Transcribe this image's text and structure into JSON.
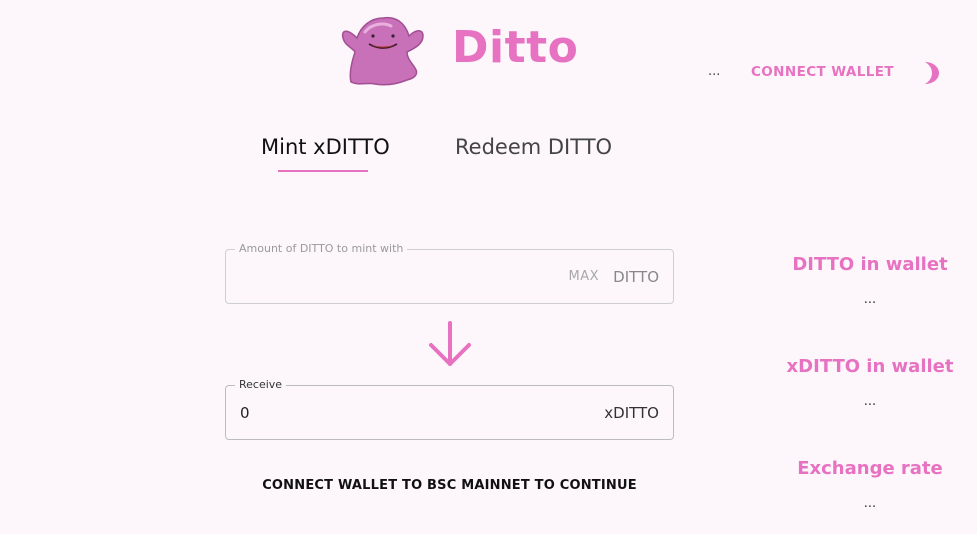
{
  "header": {
    "brand": "Ditto",
    "address_placeholder": "...",
    "connect_label": "CONNECT WALLET",
    "theme_icon": "moon-icon",
    "logo_icon": "ditto-mascot-icon",
    "accent_color": "#e772c1"
  },
  "tabs": [
    {
      "label": "Mint xDITTO",
      "active": true
    },
    {
      "label": "Redeem DITTO",
      "active": false
    }
  ],
  "mint_form": {
    "amount_label": "Amount of DITTO to mint with",
    "amount_value": "",
    "max_label": "MAX",
    "amount_unit": "DITTO",
    "arrow_icon": "arrow-down-icon",
    "receive_label": "Receive",
    "receive_value": "0",
    "receive_unit": "xDITTO",
    "notice": "CONNECT WALLET TO BSC MAINNET TO CONTINUE"
  },
  "stats": [
    {
      "label": "DITTO in wallet",
      "value": "..."
    },
    {
      "label": "xDITTO in wallet",
      "value": "..."
    },
    {
      "label": "Exchange rate",
      "value": "..."
    }
  ]
}
